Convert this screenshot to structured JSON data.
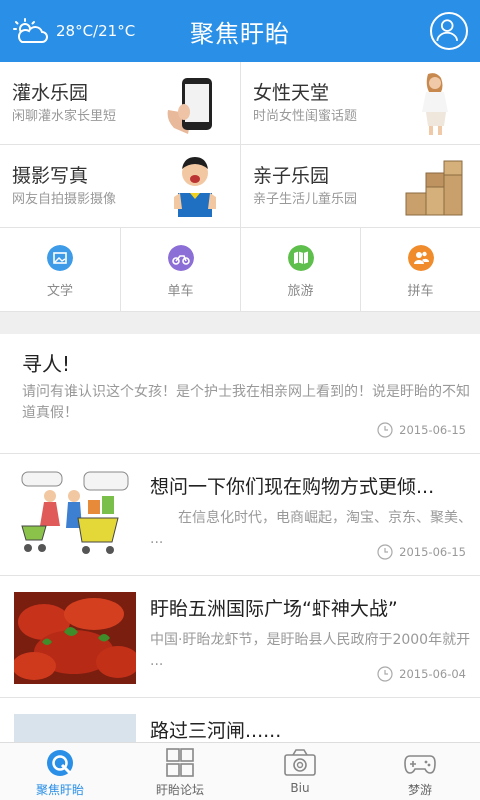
{
  "header": {
    "temperature": "28°C/21°C",
    "title": "聚焦盱眙"
  },
  "categories": [
    {
      "title": "灌水乐园",
      "subtitle": "闲聊灌水家长里短"
    },
    {
      "title": "女性天堂",
      "subtitle": "时尚女性闺蜜话题"
    },
    {
      "title": "摄影写真",
      "subtitle": "网友自拍摄影摄像"
    },
    {
      "title": "亲子乐园",
      "subtitle": "亲子生活儿童乐园"
    }
  ],
  "quick_links": [
    {
      "label": "文学",
      "color": "#3e9be8",
      "icon": "picture-icon"
    },
    {
      "label": "单车",
      "color": "#8c6fd6",
      "icon": "motorbike-icon"
    },
    {
      "label": "旅游",
      "color": "#5fbf4c",
      "icon": "map-icon"
    },
    {
      "label": "拼车",
      "color": "#f08c2c",
      "icon": "people-icon"
    }
  ],
  "posts": [
    {
      "title": "寻人!",
      "excerpt": "请问有谁认识这个女孩！是个护士我在相亲网上看到的！说是盱眙的不知道真假！",
      "date": "2015-06-15"
    },
    {
      "title": "想问一下你们现在购物方式更倾...",
      "excerpt": "　　在信息化时代，电商崛起，淘宝、京东、聚美、 ...",
      "date": "2015-06-15"
    },
    {
      "title": "盱眙五洲国际广场“虾神大战”",
      "excerpt": "中国·盱眙龙虾节，是盱眙县人民政府于2000年就开 ...",
      "date": "2015-06-04"
    },
    {
      "title": "路过三河闸......",
      "excerpt": "",
      "date": ""
    }
  ],
  "bottom_nav": [
    {
      "label": "聚焦盱眙",
      "active": true
    },
    {
      "label": "盱眙论坛",
      "active": false
    },
    {
      "label": "Biu",
      "active": false
    },
    {
      "label": "梦游",
      "active": false
    }
  ],
  "colors": {
    "brand": "#2a8fe6",
    "text_muted": "#999999"
  }
}
